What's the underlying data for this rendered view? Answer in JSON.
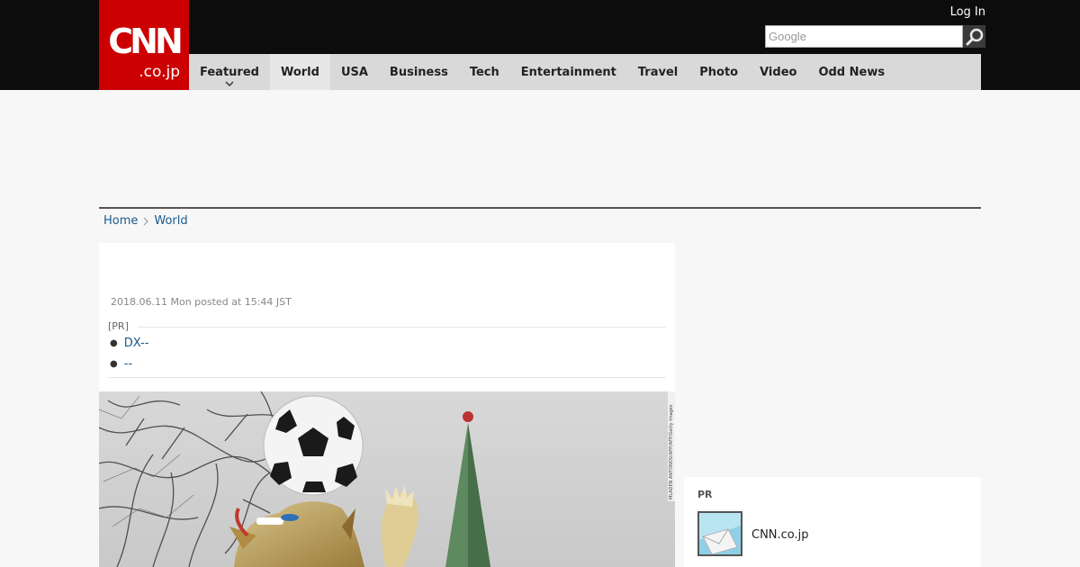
{
  "header": {
    "logo_mark": "CNN",
    "logo_sub": ".co.jp",
    "login_label": "Log In",
    "search_placeholder": "Google"
  },
  "nav": {
    "items": [
      {
        "label": "Featured"
      },
      {
        "label": "World"
      },
      {
        "label": "USA"
      },
      {
        "label": "Business"
      },
      {
        "label": "Tech"
      },
      {
        "label": "Entertainment"
      },
      {
        "label": "Travel"
      },
      {
        "label": "Photo"
      },
      {
        "label": "Video"
      },
      {
        "label": "Odd News"
      }
    ]
  },
  "breadcrumb": {
    "home": "Home",
    "current": "World"
  },
  "article": {
    "date": "2018.06.11 Mon posted at 15:44 JST",
    "pr_label": "[PR]",
    "pr_links": [
      "DX--",
      "--"
    ],
    "photo_credit": "MLADEN ANTONOV/AFP/AFP/Getty Images"
  },
  "sidebar": {
    "pr_label": "PR",
    "pr_item_text": "CNN.co.jp"
  },
  "colors": {
    "brand_red": "#cc0000",
    "topbar": "#0c0c0c",
    "nav_bg": "#d9d9d9",
    "link": "#1a5a8a"
  }
}
